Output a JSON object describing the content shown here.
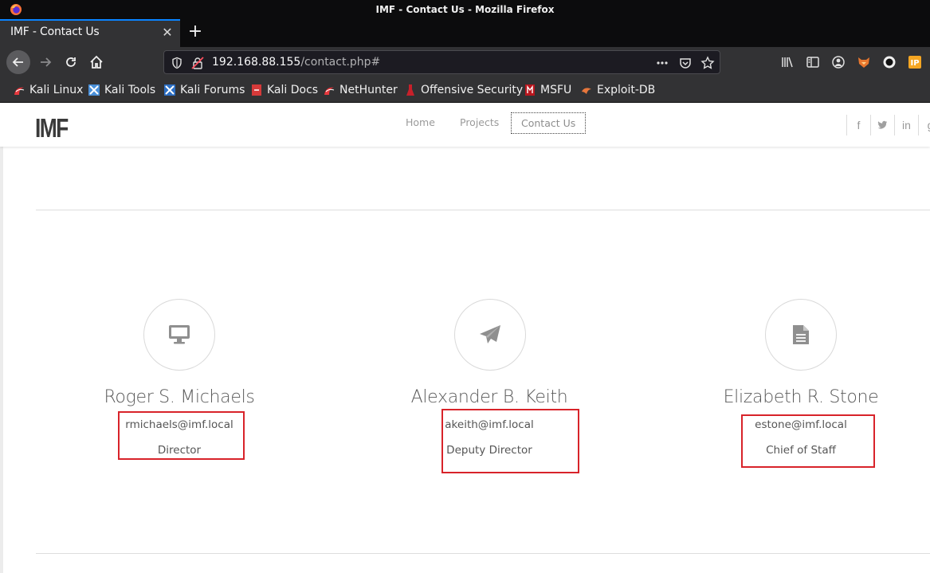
{
  "window": {
    "title": "IMF - Contact Us - Mozilla Firefox"
  },
  "tab": {
    "title": "IMF - Contact Us",
    "close_icon": "close-icon"
  },
  "address_bar": {
    "host": "192.168.88.155",
    "path": "/contact.php#"
  },
  "bookmarks": [
    {
      "label": "Kali Linux",
      "icon": "kali-icon"
    },
    {
      "label": "Kali Tools",
      "icon": "kali-tools-icon"
    },
    {
      "label": "Kali Forums",
      "icon": "kali-forums-icon"
    },
    {
      "label": "Kali Docs",
      "icon": "kali-docs-icon"
    },
    {
      "label": "NetHunter",
      "icon": "nethunter-icon"
    },
    {
      "label": "Offensive Security",
      "icon": "offsec-icon"
    },
    {
      "label": "MSFU",
      "icon": "msfu-icon"
    },
    {
      "label": "Exploit-DB",
      "icon": "exploitdb-icon"
    }
  ],
  "site": {
    "logo": "IMF",
    "menu": {
      "home": "Home",
      "projects": "Projects",
      "contact": "Contact Us"
    },
    "social": {
      "facebook": "f",
      "twitter": "t",
      "linkedin": "in",
      "google": "g"
    }
  },
  "people": [
    {
      "name": "Roger S. Michaels",
      "email": "rmichaels@imf.local",
      "role": "Director",
      "icon": "monitor-icon"
    },
    {
      "name": "Alexander B. Keith",
      "email": "akeith@imf.local",
      "role": "Deputy Director",
      "icon": "paper-plane-icon"
    },
    {
      "name": "Elizabeth R. Stone",
      "email": "estone@imf.local",
      "role": "Chief of Staff",
      "icon": "document-icon"
    }
  ],
  "colors": {
    "highlight_box": "#d8232a",
    "tab_accent": "#0a84ff"
  }
}
